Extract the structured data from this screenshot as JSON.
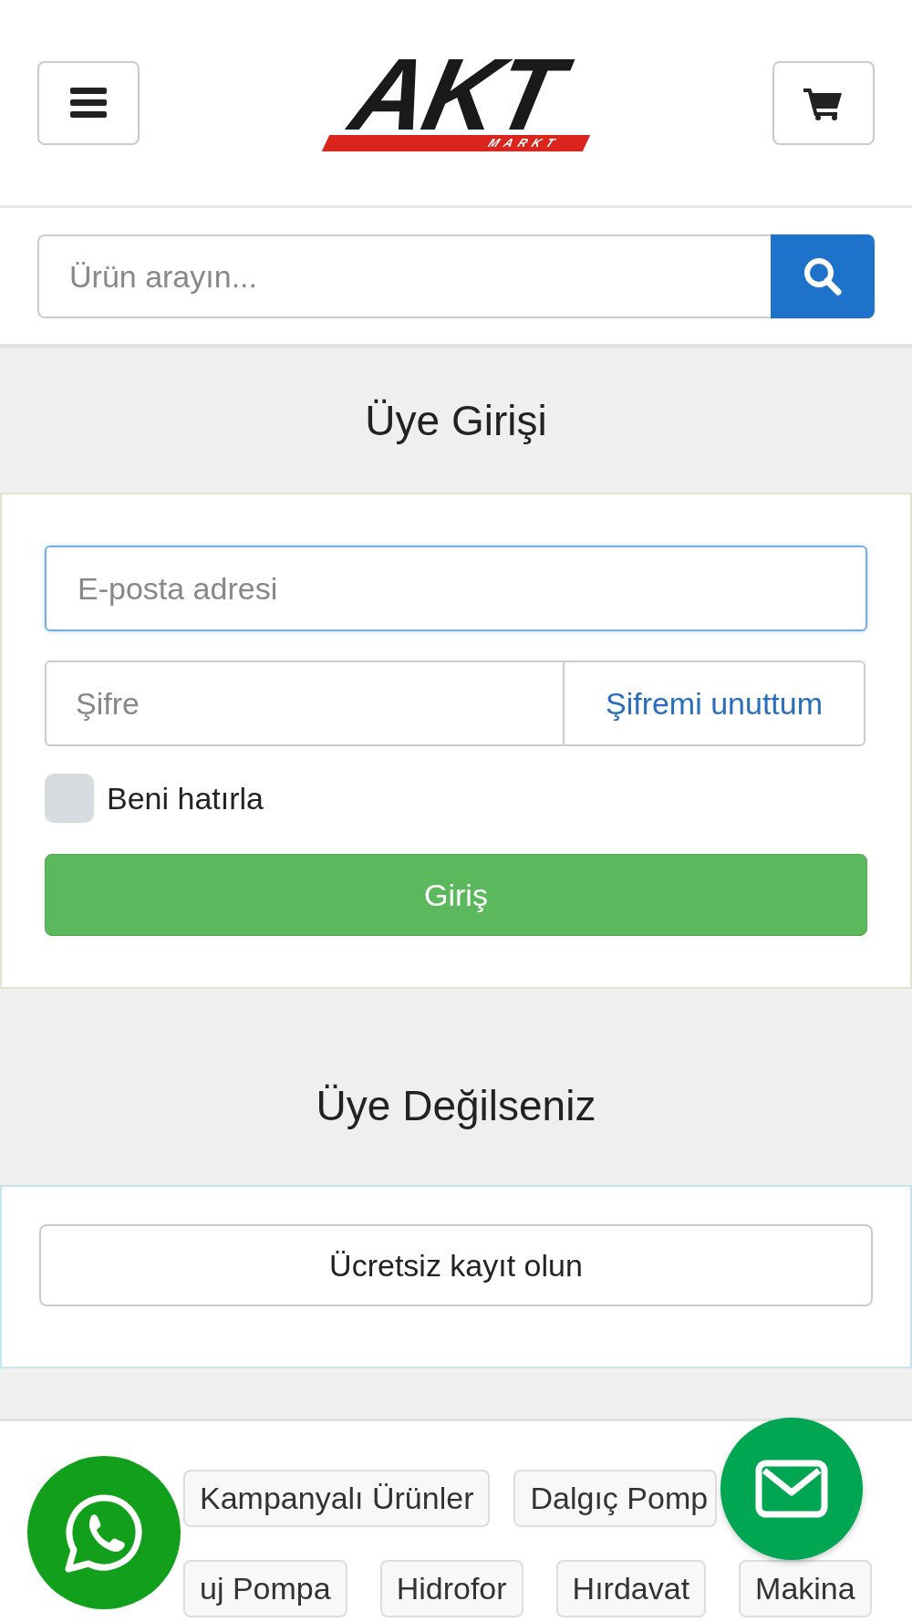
{
  "header": {
    "logo": {
      "main": "AKT",
      "sub": "MARKT"
    }
  },
  "search": {
    "placeholder": "Ürün arayın..."
  },
  "login": {
    "title": "Üye Girişi",
    "email": {
      "placeholder": "E-posta adresi"
    },
    "password": {
      "placeholder": "Şifre"
    },
    "forgot_link": "Şifremi unuttum",
    "remember": {
      "label": "Beni hatırla",
      "checked": false
    },
    "submit": "Giriş"
  },
  "register": {
    "title": "Üye Değilseniz",
    "button": "Ücretsiz kayıt olun"
  },
  "tag_rows": [
    [
      "Kampanyalı Ürünler",
      "Dalgıç Pomp"
    ],
    [
      "uj Pompa",
      "Hidrofor",
      "Hırdavat",
      "Makina"
    ]
  ]
}
